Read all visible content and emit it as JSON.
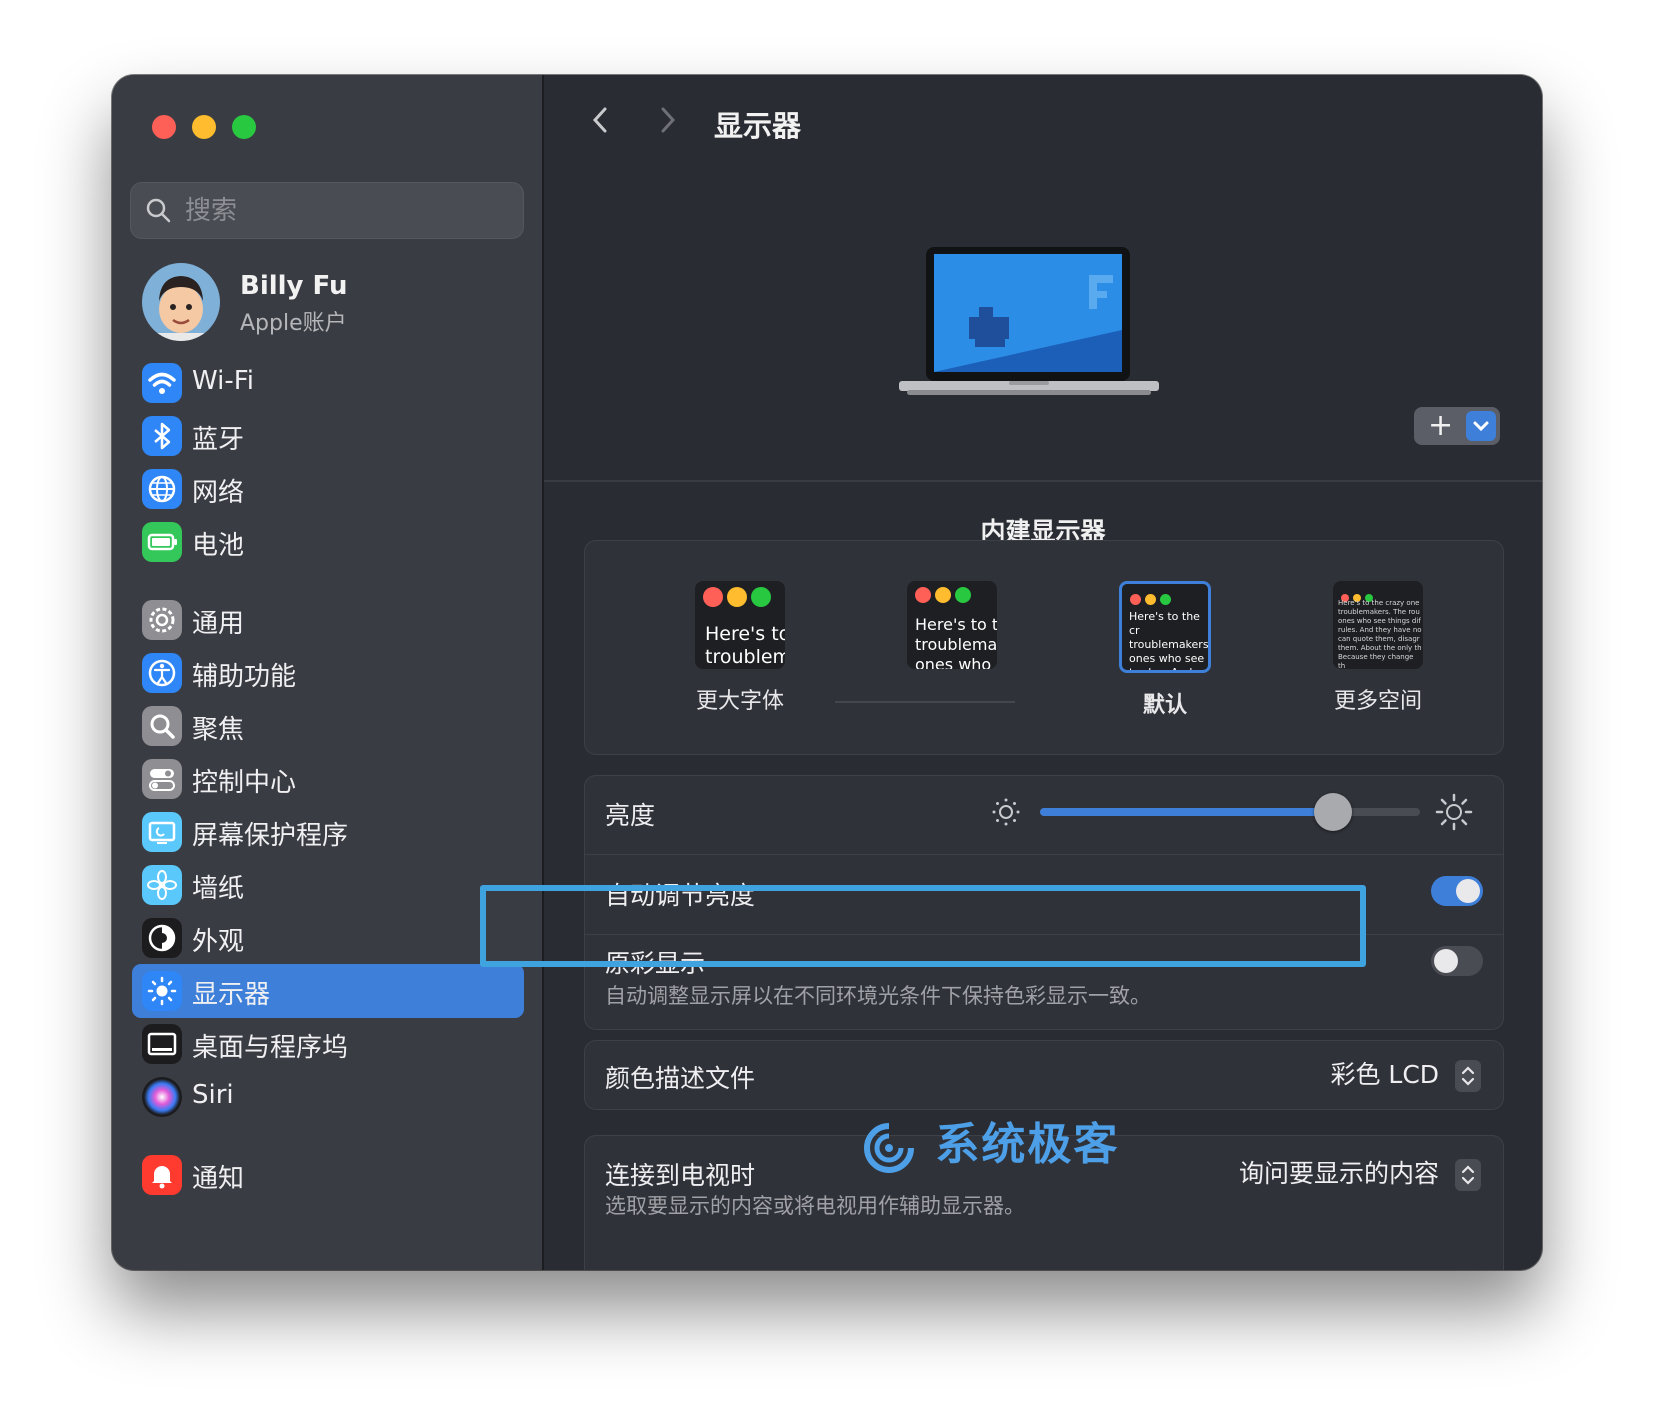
{
  "window": {
    "title": "显示器"
  },
  "sidebar": {
    "search_placeholder": "搜索",
    "account": {
      "name": "Billy Fu",
      "subtitle": "Apple账户"
    },
    "items": [
      {
        "label": "Wi-Fi",
        "icon": "wifi-icon",
        "color": "#2f86f6"
      },
      {
        "label": "蓝牙",
        "icon": "bluetooth-icon",
        "color": "#2f86f6"
      },
      {
        "label": "网络",
        "icon": "globe-icon",
        "color": "#2f86f6"
      },
      {
        "label": "电池",
        "icon": "battery-icon",
        "color": "#34c759"
      },
      {
        "label": "通用",
        "icon": "gear-icon",
        "color": "#8e8e93"
      },
      {
        "label": "辅助功能",
        "icon": "accessibility-icon",
        "color": "#2f86f6"
      },
      {
        "label": "聚焦",
        "icon": "magnifier-icon",
        "color": "#8e8e93"
      },
      {
        "label": "控制中心",
        "icon": "toggles-icon",
        "color": "#8e8e93"
      },
      {
        "label": "屏幕保护程序",
        "icon": "screensaver-icon",
        "color": "#5ac8fa"
      },
      {
        "label": "墙纸",
        "icon": "flower-icon",
        "color": "#5ac8fa"
      },
      {
        "label": "外观",
        "icon": "appearance-icon",
        "color": "#1c1c1e"
      },
      {
        "label": "显示器",
        "icon": "sun-icon",
        "color": "#2f86f6",
        "selected": true
      },
      {
        "label": "桌面与程序坞",
        "icon": "dock-icon",
        "color": "#1c1c1e"
      },
      {
        "label": "Siri",
        "icon": "siri-icon",
        "color": "#6e3bd8"
      },
      {
        "label": "通知",
        "icon": "bell-icon",
        "color": "#ff3b30"
      }
    ]
  },
  "main": {
    "title": "显示器",
    "display_name": "内建显示器",
    "add_button": "+",
    "resolution": {
      "options": [
        {
          "label": "更大字体",
          "sample": "Here's to troublem"
        },
        {
          "label": "",
          "sample": "Here's to t troublema ones who"
        },
        {
          "label": "默认",
          "sample": "Here's to the cr troublemakers. ones who see t rules. And they",
          "selected": true
        },
        {
          "label": "更多空间",
          "sample": "Here's to the crazy one troublemakers. The rou ones who see things dif rules. And they have no can quote them, disagr them. About the only th Because they change th"
        }
      ]
    },
    "brightness": {
      "label": "亮度",
      "value": 0.77
    },
    "auto_brightness": {
      "label": "自动调节亮度",
      "on": true
    },
    "true_tone": {
      "label": "原彩显示",
      "description": "自动调整显示屏以在不同环境光条件下保持色彩显示一致。",
      "on": false
    },
    "color_profile": {
      "label": "颜色描述文件",
      "value": "彩色 LCD"
    },
    "tv": {
      "label": "连接到电视时",
      "description": "选取要显示的内容或将电视用作辅助显示器。",
      "value": "询问要显示的内容"
    },
    "watermark": "系统极客"
  },
  "colors": {
    "accent": "#3d7fd9",
    "highlight": "#3fa3e0",
    "close": "#fe5f57",
    "minimize": "#febc2e",
    "zoom": "#28c840"
  }
}
